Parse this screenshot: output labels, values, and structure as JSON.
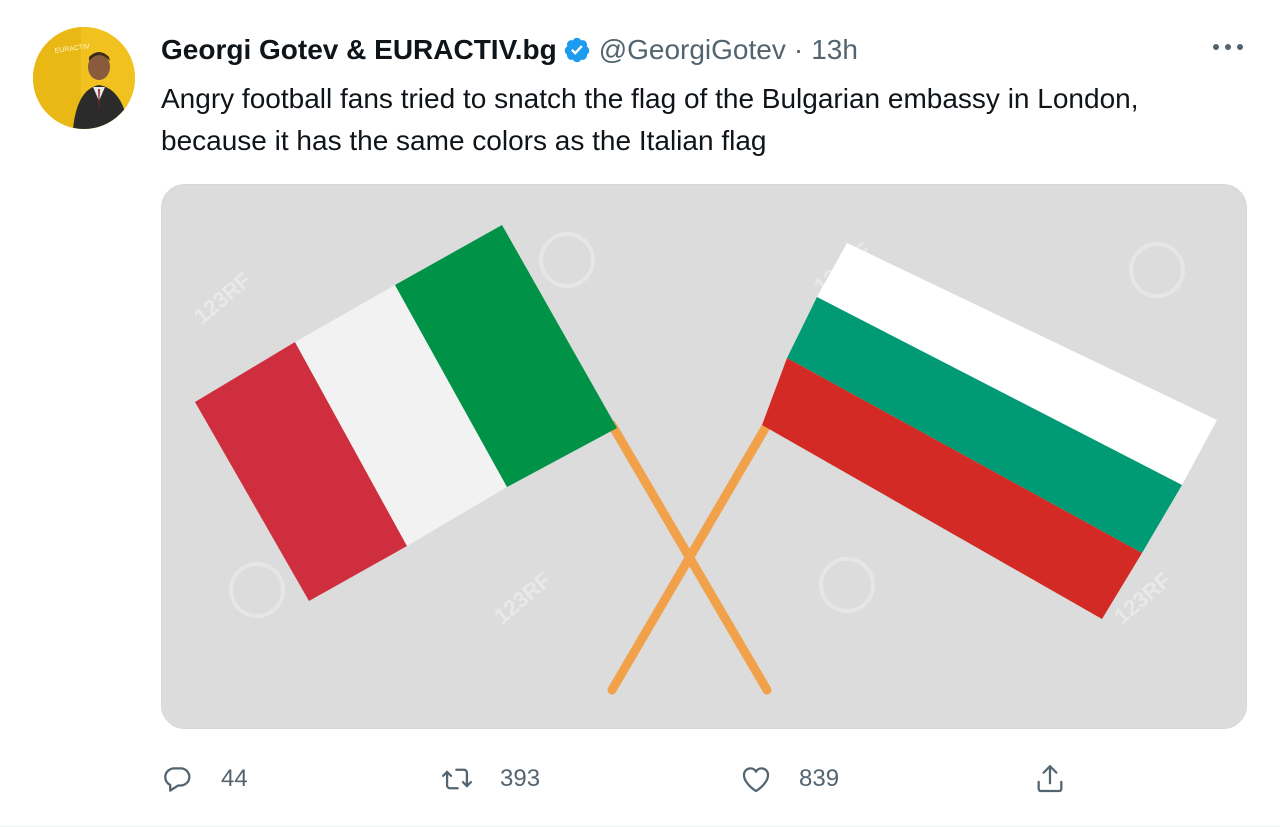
{
  "author": {
    "name": "Georgi Gotev & EURACTIV.bg",
    "handle": "@GeorgiGotev",
    "separator": "·",
    "time": "13h",
    "verified": true
  },
  "avatar_logo_text": "EURACTIV",
  "tweet_text": "Angry football fans tried to snatch the flag of the Bulgarian embassy in London, because it has the same colors as the Italian flag",
  "media": {
    "watermark_text": "123RF",
    "italian_flag_colors": [
      "#cf2e3f",
      "#f2f2f2",
      "#009246"
    ],
    "bulgarian_flag_colors": [
      "#ffffff",
      "#009b74",
      "#d42a25"
    ],
    "pole_color": "#f0a14a"
  },
  "actions": {
    "reply": {
      "icon": "reply-icon",
      "count": "44"
    },
    "retweet": {
      "icon": "retweet-icon",
      "count": "393"
    },
    "like": {
      "icon": "heart-icon",
      "count": "839"
    },
    "share": {
      "icon": "share-icon"
    }
  },
  "colors": {
    "verified_blue": "#1d9bf0",
    "muted_text": "#536471"
  }
}
